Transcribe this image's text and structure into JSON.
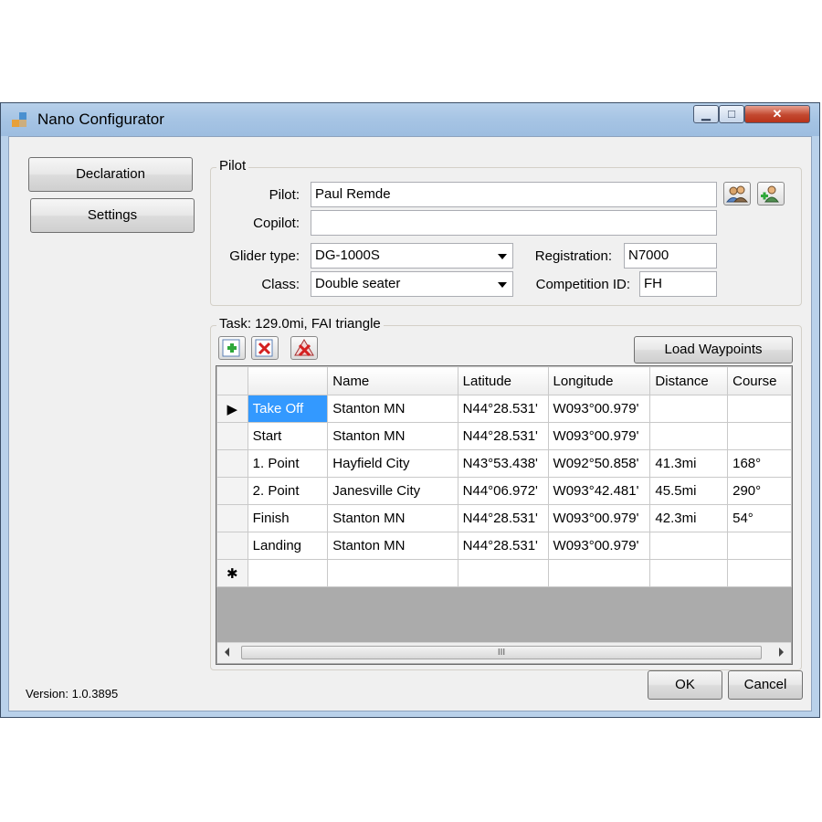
{
  "window": {
    "title": "Nano Configurator"
  },
  "nav": {
    "declaration": "Declaration",
    "settings": "Settings"
  },
  "pilot_group": {
    "legend": "Pilot",
    "pilot_label": "Pilot:",
    "pilot_value": "Paul Remde",
    "copilot_label": "Copilot:",
    "copilot_value": "",
    "glider_type_label": "Glider type:",
    "glider_type_value": "DG-1000S",
    "class_label": "Class:",
    "class_value": "Double seater",
    "registration_label": "Registration:",
    "registration_value": "N7000",
    "competition_id_label": "Competition ID:",
    "competition_id_value": "FH"
  },
  "task_group": {
    "legend": "Task: 129.0mi, FAI triangle",
    "load_waypoints": "Load Waypoints"
  },
  "grid": {
    "columns": [
      "",
      "Name",
      "Latitude",
      "Longitude",
      "Distance",
      "Course"
    ],
    "rows": [
      [
        "Take Off",
        "Stanton MN",
        "N44°28.531'",
        "W093°00.979'",
        "",
        ""
      ],
      [
        "Start",
        "Stanton MN",
        "N44°28.531'",
        "W093°00.979'",
        "",
        ""
      ],
      [
        "1. Point",
        "Hayfield City",
        "N43°53.438'",
        "W092°50.858'",
        "41.3mi",
        "168°"
      ],
      [
        "2. Point",
        "Janesville City",
        "N44°06.972'",
        "W093°42.481'",
        "45.5mi",
        "290°"
      ],
      [
        "Finish",
        "Stanton MN",
        "N44°28.531'",
        "W093°00.979'",
        "42.3mi",
        "54°"
      ],
      [
        "Landing",
        "Stanton MN",
        "N44°28.531'",
        "W093°00.979'",
        "",
        ""
      ]
    ],
    "current_row_marker": "▶",
    "new_row_marker": "✱",
    "scroll_thumb_grip": "III"
  },
  "footer": {
    "version": "Version: 1.0.3895",
    "ok": "OK",
    "cancel": "Cancel"
  },
  "icons": {
    "app": "app-icon",
    "pilot_select": "pilot-select-icon",
    "pilot_add": "pilot-add-icon",
    "waypoint_add": "add-waypoint-icon",
    "waypoint_delete": "delete-waypoint-icon",
    "task_clear": "clear-task-icon"
  },
  "colors": {
    "selection": "#3399ff",
    "close_button": "#c3482f"
  }
}
